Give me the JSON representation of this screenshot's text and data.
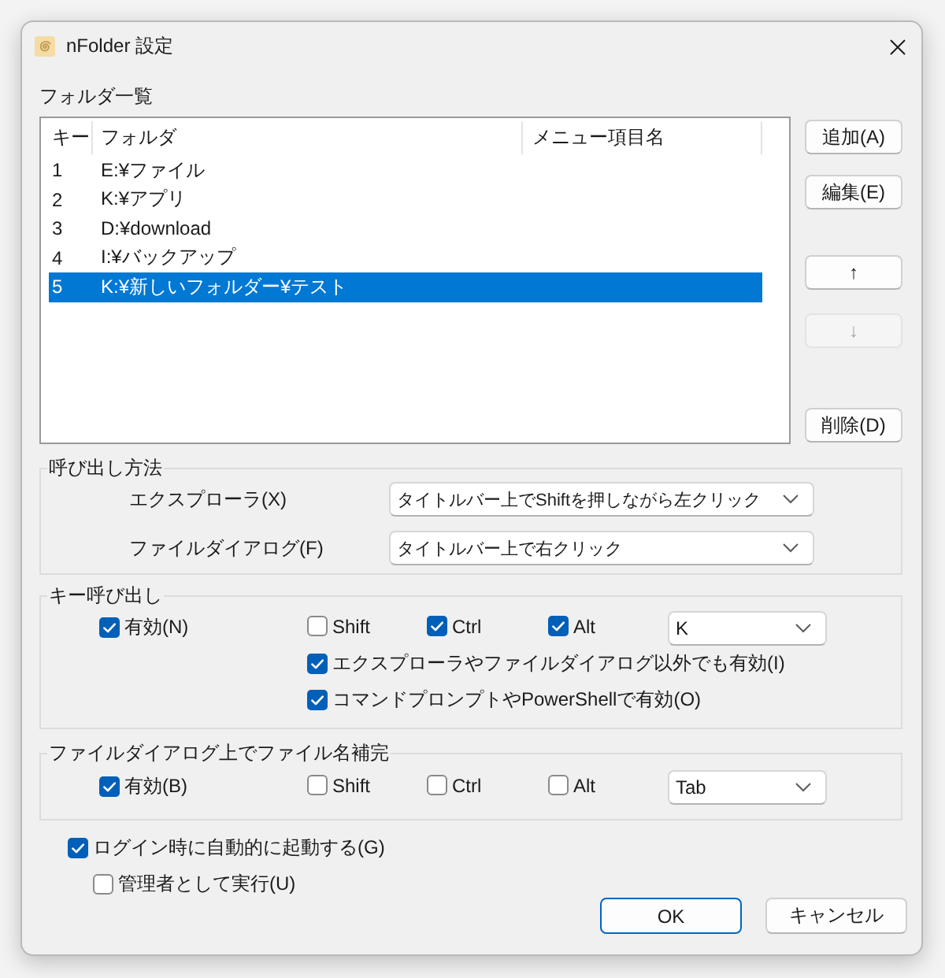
{
  "window": {
    "title": "nFolder 設定"
  },
  "folder_list": {
    "label": "フォルダ一覧",
    "columns": [
      "キー",
      "フォルダ",
      "メニュー項目名"
    ],
    "rows": [
      {
        "key": "1",
        "folder": "E:¥ファイル",
        "selected": false
      },
      {
        "key": "2",
        "folder": "K:¥アプリ",
        "selected": false
      },
      {
        "key": "3",
        "folder": "D:¥download",
        "selected": false
      },
      {
        "key": "4",
        "folder": "I:¥バックアップ",
        "selected": false
      },
      {
        "key": "5",
        "folder": "K:¥新しいフォルダー¥テスト",
        "selected": true
      }
    ]
  },
  "list_buttons": [
    {
      "label": "追加(A)",
      "disabled": false
    },
    {
      "label": "編集(E)",
      "disabled": false
    },
    {
      "label": "↑",
      "disabled": false
    },
    {
      "label": "↓",
      "disabled": true
    },
    {
      "label": "削除(D)",
      "disabled": false
    }
  ],
  "invoke_method": {
    "title": "呼び出し方法",
    "rows": [
      {
        "label": "エクスプローラ(X)",
        "value": "タイトルバー上でShiftを押しながら左クリック"
      },
      {
        "label": "ファイルダイアログ(F)",
        "value": "タイトルバー上で右クリック"
      }
    ]
  },
  "key_invoke": {
    "title": "キー呼び出し",
    "enabled": {
      "label": "有効(N)",
      "checked": true
    },
    "modifiers": [
      {
        "label": "Shift",
        "checked": false
      },
      {
        "label": "Ctrl",
        "checked": true
      },
      {
        "label": "Alt",
        "checked": true
      }
    ],
    "key": "K",
    "options": [
      {
        "label": "エクスプローラやファイルダイアログ以外でも有効(I)",
        "checked": true
      },
      {
        "label": "コマンドプロンプトやPowerShellで有効(O)",
        "checked": true
      }
    ]
  },
  "filename_completion": {
    "title": "ファイルダイアログ上でファイル名補完",
    "enabled": {
      "label": "有効(B)",
      "checked": true
    },
    "modifiers": [
      {
        "label": "Shift",
        "checked": false
      },
      {
        "label": "Ctrl",
        "checked": false
      },
      {
        "label": "Alt",
        "checked": false
      }
    ],
    "key": "Tab"
  },
  "startup": {
    "label": "ログイン時に自動的に起動する(G)",
    "checked": true
  },
  "run_as_admin": {
    "label": "管理者として実行(U)",
    "checked": false
  },
  "buttons": [
    {
      "label": "OK",
      "default": true
    },
    {
      "label": "キャンセル",
      "default": false
    }
  ]
}
